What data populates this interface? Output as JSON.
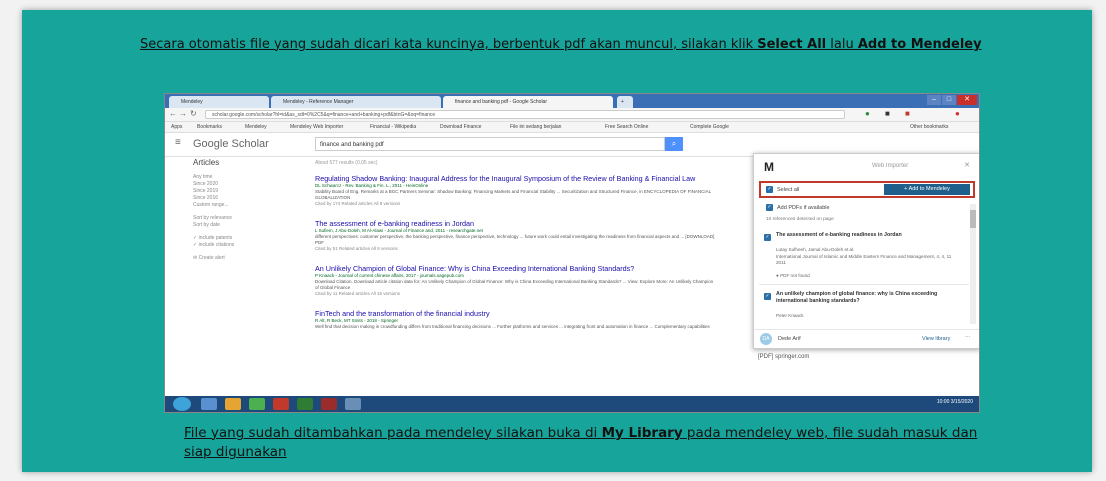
{
  "captions": {
    "top": {
      "part1": "Secara otomatis file yang sudah dicari kata kuncinya, berbentuk pdf akan muncul, silakan klik ",
      "bold1": "Select All",
      "part2": " lalu ",
      "bold2": "Add to Mendeley"
    },
    "bottom": {
      "part1": "File yang sudah ditambahkan pada mendeley silakan buka di ",
      "bold1": "My Library",
      "part2": " pada mendeley web, file sudah masuk dan siap digunakan"
    }
  },
  "browser": {
    "tabs": [
      "Mendeley",
      "Mendeley - Reference Manager",
      "finance and banking pdf - Google Scholar"
    ],
    "url": "scholar.google.com/scholar?hl=id&as_sdt=0%2C5&q=finance+and+banking+pdf&btnG=&oq=finance",
    "bookmarks": [
      "Apps",
      "Bookmarks",
      "Mendeley",
      "Mendeley Web Importer",
      "Financial - Wikipedia",
      "Download Finance",
      "File ini sedang berjalan",
      "Free Search Online",
      "Complete Google",
      "Other bookmarks"
    ]
  },
  "scholar": {
    "logo": "Google Scholar",
    "query": "finance and banking pdf",
    "articles_label": "Articles",
    "results_count": "About 577 results (0.05 sec)",
    "sidebar": [
      "Any time",
      "Since 2020",
      "Since 2019",
      "Since 2016",
      "Custom range...",
      "",
      "Sort by relevance",
      "Sort by date",
      "",
      "include patents",
      "include citations",
      "",
      "Create alert"
    ],
    "results": [
      {
        "title": "Regulating Shadow Banking: Inaugural Address for the Inaugural Symposium of the Review of Banking & Financial Law",
        "meta": "DL Schwarcz - Rev. Banking & Fin. L., 2011 - HeinOnline",
        "snippet": "Stability Board of Eng. Remarks at a BGC Partners Seminar: Shadow Banking: Financing Markets and Financial Stability ... Securitization and Structured Finance, in ENCYCLOPEDIA OF FINANCIAL GLOBALIZATION",
        "links": "Cited by 174  Related articles  All 8 versions"
      },
      {
        "title": "The assessment of e-banking readiness in Jordan",
        "meta": "L Sufiem, J Abu-Doleh, M Al-Alawi - Journal of Finance and, 2011 - researchgate.net",
        "snippet": "different perspectives: customer perspective, the banking perspective, finance perspective, technology ... future work could entail investigating the readiness from financial aspects and ... [DOWNLOAD] PDF",
        "links": "Cited by 51  Related articles  All 8 versions"
      },
      {
        "title": "An Unlikely Champion of Global Finance: Why is China Exceeding International Banking Standards?",
        "meta": "P Knaack - Journal of current chinese affairs, 2017 - journals.sagepub.com",
        "snippet": "Download Citation. Download article citation data for: An Unlikely Champion of Global Finance: Why is China Exceeding International Banking Standards? ... View: Explore More: An Unlikely Champion of Global Finance",
        "links": "Cited by 11  Related articles  All 15 versions"
      },
      {
        "title": "FinTech and the transformation of the financial industry",
        "meta": "R Alt, R Beck, MT Smits - 2018 - Springer",
        "snippet": "Well find that decision making in crowdfunding differs from traditional financing decisions ... Further platforms and services ... integrating front and automation in finance ... Complementary capabilities",
        "links": ""
      }
    ],
    "springer_link": "[PDF] springer.com"
  },
  "importer": {
    "logo": "M",
    "title": "Web Importer",
    "select_all": "Select all",
    "add_button": "+ Add to Mendeley",
    "add_pdfs": "Add PDFs if available",
    "note": "10 references detected on page",
    "items": [
      {
        "title": "The assessment of e-banking readiness in Jordan",
        "authors": "Lutay Sufheeh, Jamal Abu-Doleh et al.",
        "journal": "International Journal of Islamic and Middle Eastern Finance and Management, 4, 4, 11 2011",
        "pdf": "PDF not found"
      },
      {
        "title": "An unlikely champion of global finance: why is China exceeding international banking standards?",
        "authors": "Peter Knaack",
        "journal": "",
        "pdf": ""
      }
    ],
    "user": "Dede Arif",
    "view_library": "View library"
  },
  "taskbar": {
    "clock": "10:00 3/15/2020"
  }
}
